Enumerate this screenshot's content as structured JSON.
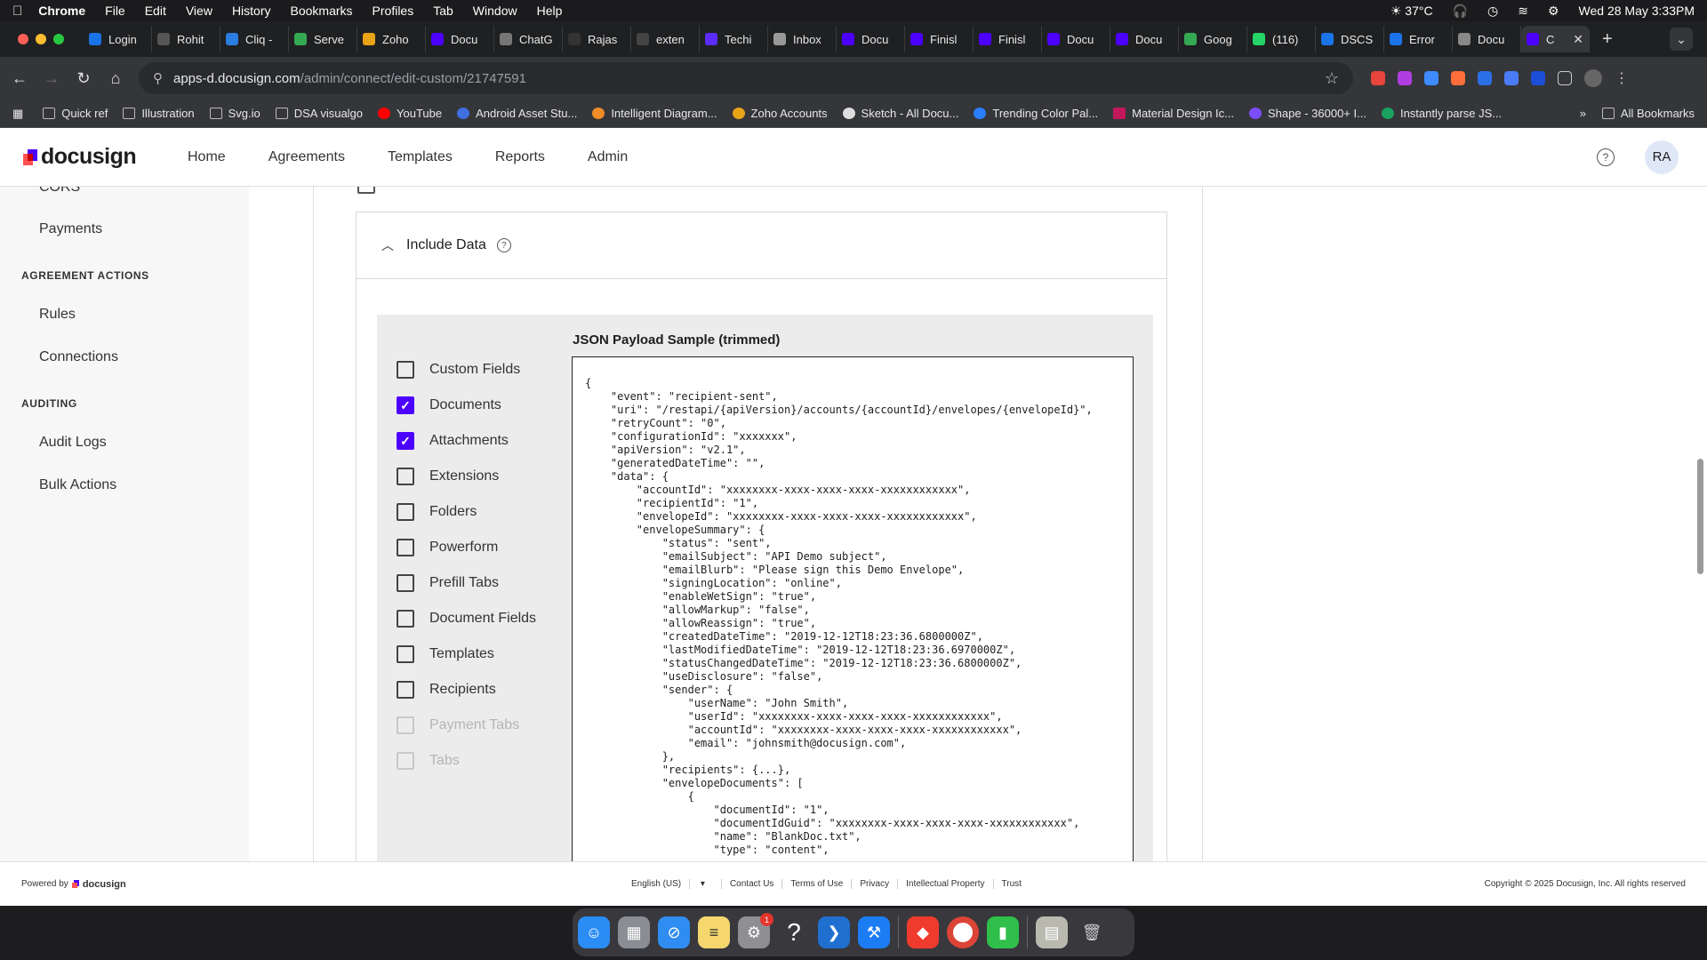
{
  "menubar": {
    "app": "Chrome",
    "items": [
      "File",
      "Edit",
      "View",
      "History",
      "Bookmarks",
      "Profiles",
      "Tab",
      "Window",
      "Help"
    ],
    "weather": "37°C",
    "datetime": "Wed 28 May  3:33PM"
  },
  "tabs": [
    {
      "label": "Login",
      "color": "#1a73e8"
    },
    {
      "label": "Rohit",
      "color": "#555"
    },
    {
      "label": "Cliq -",
      "color": "#2a7de1"
    },
    {
      "label": "Serve",
      "color": "#34a853"
    },
    {
      "label": "Zoho",
      "color": "#e8a317"
    },
    {
      "label": "Docu",
      "color": "#4c00ff"
    },
    {
      "label": "ChatG",
      "color": "#777"
    },
    {
      "label": "Rajas",
      "color": "#333"
    },
    {
      "label": "exten",
      "color": "#444"
    },
    {
      "label": "Techi",
      "color": "#5b2bff"
    },
    {
      "label": "Inbox",
      "color": "#999"
    },
    {
      "label": "Docu",
      "color": "#4c00ff"
    },
    {
      "label": "Finisl",
      "color": "#4c00ff"
    },
    {
      "label": "Finisl",
      "color": "#4c00ff"
    },
    {
      "label": "Docu",
      "color": "#4c00ff"
    },
    {
      "label": "Docu",
      "color": "#4c00ff"
    },
    {
      "label": "Goog",
      "color": "#34a853"
    },
    {
      "label": "(116)",
      "color": "#25d366"
    },
    {
      "label": "DSCS",
      "color": "#1a73e8"
    },
    {
      "label": "Error",
      "color": "#1a73e8"
    },
    {
      "label": "Docu",
      "color": "#888"
    },
    {
      "label": "C",
      "color": "#4c00ff",
      "active": true
    }
  ],
  "url": {
    "host": "apps-d.docusign.com",
    "path": "/admin/connect/edit-custom/21747591"
  },
  "bookmarks": [
    "Quick ref",
    "Illustration",
    "Svg.io",
    "DSA visualgo",
    "YouTube",
    "Android Asset Stu...",
    "Intelligent Diagram...",
    "Zoho Accounts",
    "Sketch - All Docu...",
    "Trending Color Pal...",
    "Material Design Ic...",
    "Shape - 36000+ I...",
    "Instantly parse JS..."
  ],
  "bookmarks_more": "»",
  "all_bookmarks": "All Bookmarks",
  "header": {
    "logo": "docusign",
    "nav": [
      "Home",
      "Agreements",
      "Templates",
      "Reports",
      "Admin"
    ],
    "avatar": "RA",
    "help": "?"
  },
  "sidebar": {
    "cors": "CORS",
    "payments": "Payments",
    "agreement_actions": "AGREEMENT ACTIONS",
    "rules": "Rules",
    "connections": "Connections",
    "auditing": "AUDITING",
    "audit_logs": "Audit Logs",
    "bulk_actions": "Bulk Actions"
  },
  "include": {
    "title": "Include Data",
    "options": [
      {
        "label": "Custom Fields",
        "checked": false,
        "disabled": false
      },
      {
        "label": "Documents",
        "checked": true,
        "disabled": false
      },
      {
        "label": "Attachments",
        "checked": true,
        "disabled": false
      },
      {
        "label": "Extensions",
        "checked": false,
        "disabled": false
      },
      {
        "label": "Folders",
        "checked": false,
        "disabled": false
      },
      {
        "label": "Powerform",
        "checked": false,
        "disabled": false
      },
      {
        "label": "Prefill Tabs",
        "checked": false,
        "disabled": false
      },
      {
        "label": "Document Fields",
        "checked": false,
        "disabled": false
      },
      {
        "label": "Templates",
        "checked": false,
        "disabled": false
      },
      {
        "label": "Recipients",
        "checked": false,
        "disabled": false
      },
      {
        "label": "Payment Tabs",
        "checked": false,
        "disabled": true
      },
      {
        "label": "Tabs",
        "checked": false,
        "disabled": true
      }
    ],
    "json_title": "JSON Payload Sample (trimmed)",
    "json_text": "{\n    \"event\": \"recipient-sent\",\n    \"uri\": \"/restapi/{apiVersion}/accounts/{accountId}/envelopes/{envelopeId}\",\n    \"retryCount\": \"0\",\n    \"configurationId\": \"xxxxxxx\",\n    \"apiVersion\": \"v2.1\",\n    \"generatedDateTime\": \"\",\n    \"data\": {\n        \"accountId\": \"xxxxxxxx-xxxx-xxxx-xxxx-xxxxxxxxxxxx\",\n        \"recipientId\": \"1\",\n        \"envelopeId\": \"xxxxxxxx-xxxx-xxxx-xxxx-xxxxxxxxxxxx\",\n        \"envelopeSummary\": {\n            \"status\": \"sent\",\n            \"emailSubject\": \"API Demo subject\",\n            \"emailBlurb\": \"Please sign this Demo Envelope\",\n            \"signingLocation\": \"online\",\n            \"enableWetSign\": \"true\",\n            \"allowMarkup\": \"false\",\n            \"allowReassign\": \"true\",\n            \"createdDateTime\": \"2019-12-12T18:23:36.6800000Z\",\n            \"lastModifiedDateTime\": \"2019-12-12T18:23:36.6970000Z\",\n            \"statusChangedDateTime\": \"2019-12-12T18:23:36.6800000Z\",\n            \"useDisclosure\": \"false\",\n            \"sender\": {\n                \"userName\": \"John Smith\",\n                \"userId\": \"xxxxxxxx-xxxx-xxxx-xxxx-xxxxxxxxxxxx\",\n                \"accountId\": \"xxxxxxxx-xxxx-xxxx-xxxx-xxxxxxxxxxxx\",\n                \"email\": \"johnsmith@docusign.com\",\n            },\n            \"recipients\": {...},\n            \"envelopeDocuments\": [\n                {\n                    \"documentId\": \"1\",\n                    \"documentIdGuid\": \"xxxxxxxx-xxxx-xxxx-xxxx-xxxxxxxxxxxx\",\n                    \"name\": \"BlankDoc.txt\",\n                    \"type\": \"content\","
  },
  "footer": {
    "powered_by": "Powered by",
    "logo": "docusign",
    "language": "English (US)",
    "links": [
      "Contact Us",
      "Terms of Use",
      "Privacy",
      "Intellectual Property",
      "Trust"
    ],
    "copyright": "Copyright © 2025 Docusign, Inc. All rights reserved"
  },
  "dock": {
    "settings_badge": "1",
    "apps": [
      "finder",
      "launchpad",
      "safari",
      "notes",
      "system-settings",
      "help",
      "vscode",
      "xcode",
      "anydesk",
      "chrome",
      "numbers",
      "archive",
      "trash"
    ]
  }
}
